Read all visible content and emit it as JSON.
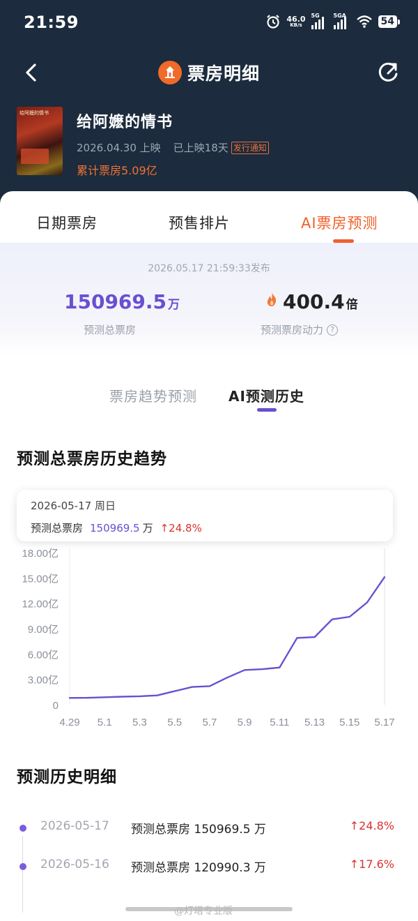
{
  "status": {
    "time": "21:59",
    "net_speed": "46.0",
    "net_unit": "KB/s",
    "sig1": "5G",
    "sig2": "5GA",
    "battery": "54"
  },
  "nav": {
    "title": "票房明细",
    "back_icon": "chevron-left-icon",
    "refresh_icon": "refresh-icon"
  },
  "movie": {
    "title": "给阿嬷的情书",
    "release": "2026.04.30 上映",
    "days": "已上映18天",
    "badge": "发行通知",
    "box_office": "累计票房5.09亿",
    "poster_text": "给阿嬷的情书"
  },
  "tabs": [
    {
      "label": "日期票房"
    },
    {
      "label": "预售排片"
    },
    {
      "label": "AI票房预测"
    }
  ],
  "prediction": {
    "published": "2026.05.17 21:59:33发布",
    "total_value": "150969.5",
    "total_unit": "万",
    "total_label": "预测总票房",
    "power_value": "400.4",
    "power_unit": "倍",
    "power_label": "预测票房动力",
    "help_glyph": "?"
  },
  "subtabs": [
    {
      "label": "票房趋势预测"
    },
    {
      "label": "AI预测历史"
    }
  ],
  "trend": {
    "title": "预测总票房历史趋势",
    "tooltip": {
      "date": "2026-05-17  周日",
      "label": "预测总票房",
      "value": "150969.5",
      "unit": "万",
      "change": "↑24.8%"
    }
  },
  "chart_data": {
    "type": "line",
    "title": "预测总票房历史趋势",
    "x": [
      "4.29",
      "4.30",
      "5.1",
      "5.2",
      "5.3",
      "5.4",
      "5.5",
      "5.6",
      "5.7",
      "5.8",
      "5.9",
      "5.10",
      "5.11",
      "5.12",
      "5.13",
      "5.14",
      "5.15",
      "5.16",
      "5.17"
    ],
    "x_tick_labels": [
      "4.29",
      "5.1",
      "5.3",
      "5.5",
      "5.7",
      "5.9",
      "5.11",
      "5.13",
      "5.15",
      "5.17"
    ],
    "y_tick_labels": [
      "0",
      "3.00亿",
      "6.00亿",
      "9.00亿",
      "12.00亿",
      "15.00亿",
      "18.00亿"
    ],
    "series": [
      {
        "values": [
          0.8,
          0.82,
          0.88,
          0.95,
          1.0,
          1.1,
          1.6,
          2.1,
          2.2,
          3.2,
          4.1,
          4.2,
          4.4,
          7.9,
          8.0,
          10.1,
          10.4,
          12.1,
          15.1
        ]
      }
    ],
    "ylim": [
      0,
      18
    ],
    "y_unit": "亿",
    "color": "#6a4fd0",
    "grid": false
  },
  "history": {
    "title": "预测历史明细",
    "rows": [
      {
        "date": "2026-05-17",
        "text": "预测总票房 150969.5 万",
        "change": "↑24.8%"
      },
      {
        "date": "2026-05-16",
        "text": "预测总票房 120990.3 万",
        "change": "↑17.6%"
      }
    ]
  },
  "watermark": "@灯塔专业版",
  "colors": {
    "header_bg": "#1c2b3d",
    "accent_orange": "#f0602a",
    "accent_purple": "#6a4fd0",
    "up_red": "#d8322e"
  }
}
